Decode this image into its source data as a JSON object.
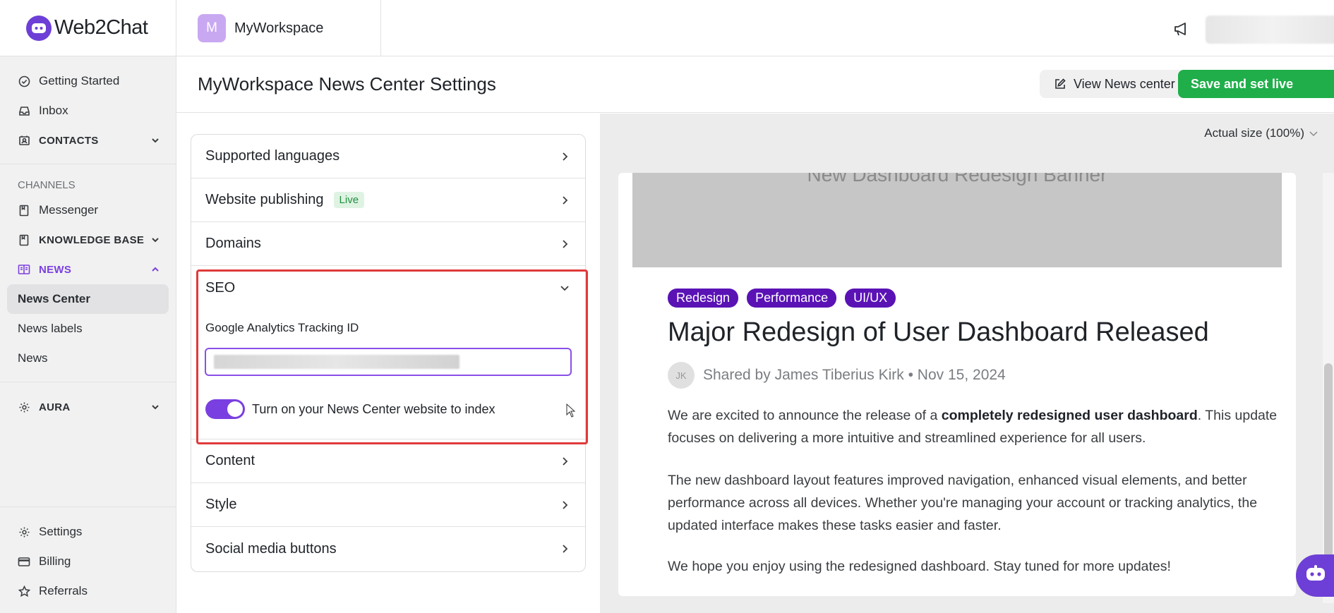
{
  "brand": {
    "name": "Web2Chat",
    "icon": "chat-bot-icon",
    "accent": "#7a3fe0"
  },
  "workspace": {
    "initial": "M",
    "name": "MyWorkspace"
  },
  "sidebar": {
    "top_items": [
      {
        "label": "Getting Started",
        "icon": "check-circle-icon"
      },
      {
        "label": "Inbox",
        "icon": "inbox-icon"
      },
      {
        "label": "CONTACTS",
        "icon": "contacts-icon"
      }
    ],
    "channels_heading": "CHANNELS",
    "channel_items": [
      {
        "label": "Messenger",
        "icon": "book-icon"
      },
      {
        "label": "KNOWLEDGE BASE",
        "icon": "book-icon"
      },
      {
        "label": "NEWS",
        "icon": "newspaper-icon"
      }
    ],
    "news_sub_items": [
      "News Center",
      "News labels",
      "News"
    ],
    "aura": {
      "label": "AURA",
      "icon": "gear-icon"
    },
    "bottom_items": [
      {
        "label": "Settings",
        "icon": "gear-icon"
      },
      {
        "label": "Billing",
        "icon": "credit-card-icon"
      },
      {
        "label": "Referrals",
        "icon": "star-icon"
      }
    ]
  },
  "header": {
    "title": "MyWorkspace News Center Settings",
    "view_label": "View News center",
    "save_label": "Save and set live",
    "save_color": "#1fae4a"
  },
  "settings": {
    "supported_languages": "Supported languages",
    "website_publishing": "Website publishing",
    "live_badge": "Live",
    "domains": "Domains",
    "seo": {
      "title": "SEO",
      "ga_label": "Google Analytics Tracking ID",
      "ga_value": "",
      "index_toggle_label": "Turn on your News Center website to index",
      "index_toggle_on": true
    },
    "content": "Content",
    "style": "Style",
    "social_media_buttons": "Social media buttons"
  },
  "preview": {
    "zoom_label": "Actual size (100%)",
    "banner_text": "New Dashboard Redesign Banner",
    "tags": [
      "Redesign",
      "Performance",
      "UI/UX"
    ],
    "tag_color": "#5a12b5",
    "title": "Major Redesign of User Dashboard Released",
    "author_initials": "JK",
    "meta": "Shared by James Tiberius Kirk • Nov 15, 2024",
    "p1_before": "We are excited to announce the release of a ",
    "p1_bold": "completely redesigned user dashboard",
    "p1_after": ". This update focuses on delivering a more intuitive and streamlined experience for all users.",
    "p2": "The new dashboard layout features improved navigation, enhanced visual elements, and better performance across all devices. Whether you're managing your account or tracking analytics, the updated interface makes these tasks easier and faster.",
    "p3": "We hope you enjoy using the redesigned dashboard. Stay tuned for more updates!"
  }
}
